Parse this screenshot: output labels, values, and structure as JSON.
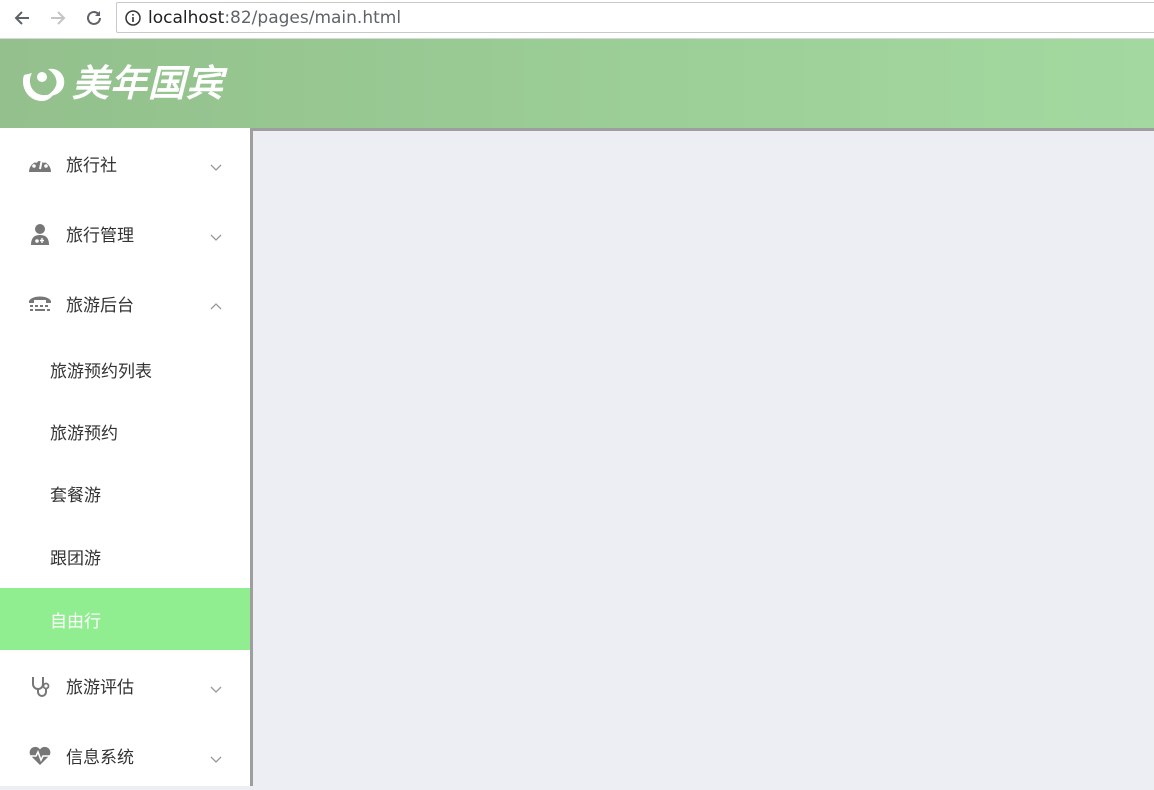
{
  "browser": {
    "url_host": "localhost",
    "url_rest": ":82/pages/main.html"
  },
  "header": {
    "logo_text": "美年国宾",
    "bg_color_start": "#93c08c",
    "bg_color_end": "#a3d9a0"
  },
  "sidebar": {
    "menus": [
      {
        "label": "旅行社",
        "icon": "dashboard-icon",
        "expanded": false
      },
      {
        "label": "旅行管理",
        "icon": "user-md-icon",
        "expanded": false
      },
      {
        "label": "旅游后台",
        "icon": "tty-icon",
        "expanded": true,
        "children": [
          {
            "label": "旅游预约列表",
            "active": false
          },
          {
            "label": "旅游预约",
            "active": false
          },
          {
            "label": "套餐游",
            "active": false
          },
          {
            "label": "跟团游",
            "active": false
          },
          {
            "label": "自由行",
            "active": true
          }
        ]
      },
      {
        "label": "旅游评估",
        "icon": "stethoscope-icon",
        "expanded": false
      },
      {
        "label": "信息系统",
        "icon": "heartbeat-icon",
        "expanded": false
      }
    ],
    "active_color": "#90ee90"
  }
}
